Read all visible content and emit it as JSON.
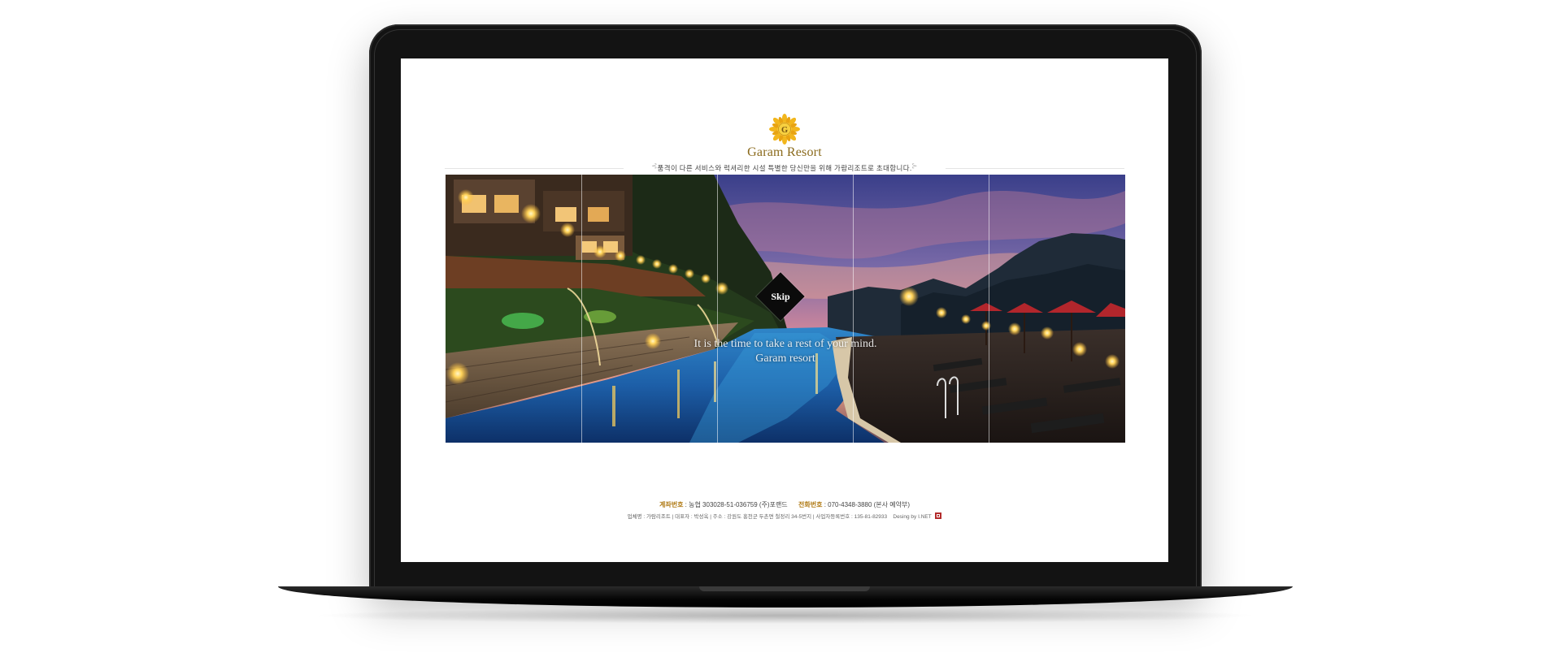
{
  "logo": {
    "letter": "G",
    "name": "Garam Resort",
    "colors": {
      "petal": "#f2b61c",
      "center": "#f7d040",
      "text": "#8a6a1c"
    }
  },
  "tagline": "품격이 다른 서비스와 럭셔리한 시설 특별한 당신만을 위해 가람리조트로 초대합니다.",
  "hero": {
    "skip_label": "Skip",
    "caption_line1": "It is the time to take a rest of your mind.",
    "caption_line2": "Garam resort",
    "prev_icon": "chevron-left-icon",
    "next_icon": "chevron-right-icon"
  },
  "footer": {
    "account_key": "계좌번호",
    "account_value": ": 농협 303028-51-036759 (주)포랜드",
    "phone_key": "전화번호",
    "phone_value": ": 070-4348-3880 (본사 예약부)",
    "info": "업체명 : 가람리조트  |  대표자 : 박성옥  |  주소 : 강원도 홍천군 두촌면 철정리 34-5번지  |  사업자등록번호 : 135-81-82933",
    "credit": "Desing by I.NET"
  },
  "colors": {
    "accent": "#b07a14",
    "bezel": "#131313"
  }
}
